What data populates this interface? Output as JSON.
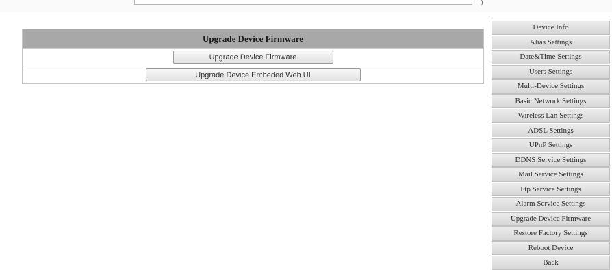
{
  "panel": {
    "title": "Upgrade Device Firmware",
    "buttons": [
      {
        "label": "Upgrade Device Firmware"
      },
      {
        "label": "Upgrade Device Embeded Web UI"
      }
    ]
  },
  "sidebar": {
    "items": [
      {
        "label": "Device Info"
      },
      {
        "label": "Alias Settings"
      },
      {
        "label": "Date&Time Settings"
      },
      {
        "label": "Users Settings"
      },
      {
        "label": "Multi-Device Settings"
      },
      {
        "label": "Basic Network Settings"
      },
      {
        "label": "Wireless Lan Settings"
      },
      {
        "label": "ADSL Settings"
      },
      {
        "label": "UPnP Settings"
      },
      {
        "label": "DDNS Service Settings"
      },
      {
        "label": "Mail Service Settings"
      },
      {
        "label": "Ftp Service Settings"
      },
      {
        "label": "Alarm Service Settings"
      },
      {
        "label": "Upgrade Device Firmware"
      },
      {
        "label": "Restore Factory Settings"
      },
      {
        "label": "Reboot Device"
      },
      {
        "label": "Back"
      }
    ]
  }
}
